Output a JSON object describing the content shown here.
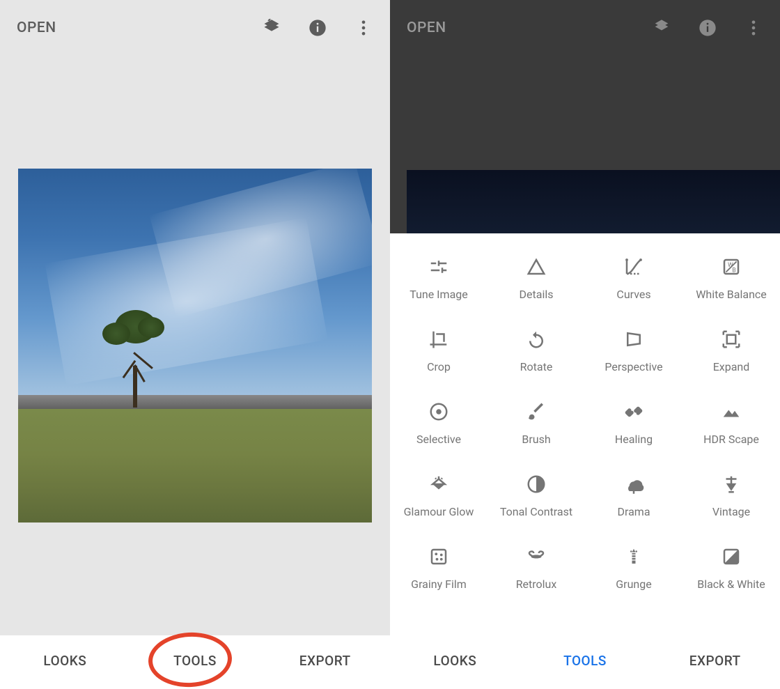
{
  "left": {
    "open_label": "OPEN",
    "nav": {
      "looks": "LOOKS",
      "tools": "TOOLS",
      "export": "EXPORT"
    }
  },
  "right": {
    "open_label": "OPEN",
    "nav": {
      "looks": "LOOKS",
      "tools": "TOOLS",
      "export": "EXPORT"
    },
    "tools": [
      {
        "id": "tune-image",
        "label": "Tune Image"
      },
      {
        "id": "details",
        "label": "Details"
      },
      {
        "id": "curves",
        "label": "Curves"
      },
      {
        "id": "white-balance",
        "label": "White Balance"
      },
      {
        "id": "crop",
        "label": "Crop"
      },
      {
        "id": "rotate",
        "label": "Rotate"
      },
      {
        "id": "perspective",
        "label": "Perspective"
      },
      {
        "id": "expand",
        "label": "Expand"
      },
      {
        "id": "selective",
        "label": "Selective"
      },
      {
        "id": "brush",
        "label": "Brush"
      },
      {
        "id": "healing",
        "label": "Healing"
      },
      {
        "id": "hdr-scape",
        "label": "HDR Scape"
      },
      {
        "id": "glamour-glow",
        "label": "Glamour Glow"
      },
      {
        "id": "tonal-contrast",
        "label": "Tonal Contrast"
      },
      {
        "id": "drama",
        "label": "Drama"
      },
      {
        "id": "vintage",
        "label": "Vintage"
      },
      {
        "id": "grainy-film",
        "label": "Grainy Film"
      },
      {
        "id": "retrolux",
        "label": "Retrolux"
      },
      {
        "id": "grunge",
        "label": "Grunge"
      },
      {
        "id": "black-white",
        "label": "Black & White"
      }
    ]
  }
}
